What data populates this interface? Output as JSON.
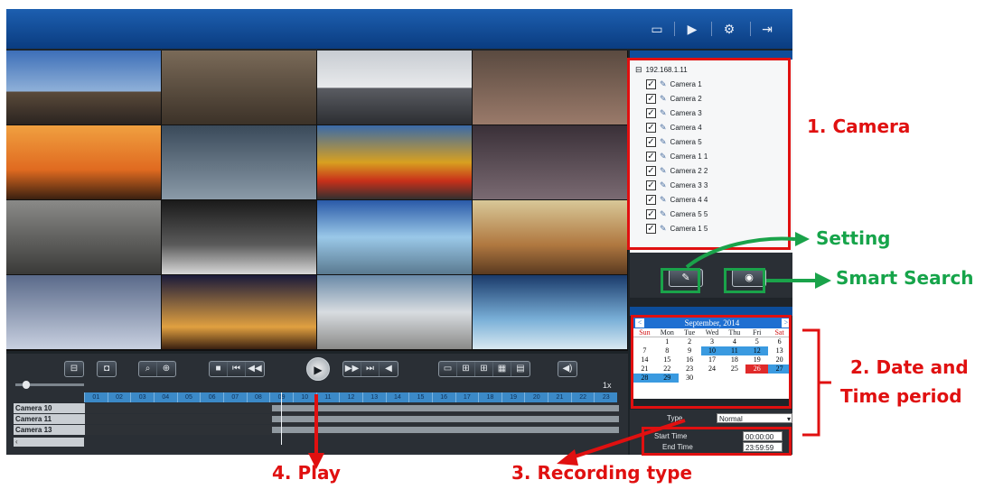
{
  "topbar": {
    "icons": [
      "monitor-icon",
      "play-box-icon",
      "gear-icon",
      "exit-icon"
    ]
  },
  "controls": {
    "zoom_level": "1x",
    "hours": [
      "01",
      "02",
      "03",
      "04",
      "05",
      "06",
      "07",
      "08",
      "09",
      "10",
      "11",
      "12",
      "13",
      "14",
      "15",
      "16",
      "17",
      "18",
      "19",
      "20",
      "21",
      "22",
      "23"
    ]
  },
  "timeline": {
    "rows": [
      "Camera 10",
      "Camera 11",
      "Camera 13"
    ]
  },
  "device": {
    "ip": "192.168.1.11"
  },
  "cameras": [
    "Camera 1",
    "Camera 2",
    "Camera 3",
    "Camera 4",
    "Camera 5",
    "Camera 1 1",
    "Camera 2 2",
    "Camera 3 3",
    "Camera 4 4",
    "Camera 5 5",
    "Camera 1 5"
  ],
  "calendar": {
    "title": "September, 2014",
    "prev": "<",
    "next": ">",
    "weekdays": [
      "Sun",
      "Mon",
      "Tue",
      "Wed",
      "Thu",
      "Fri",
      "Sat"
    ],
    "weeks": [
      [
        "",
        "1",
        "2",
        "3",
        "4",
        "5",
        "6"
      ],
      [
        "7",
        "8",
        "9",
        "10",
        "11",
        "12",
        "13"
      ],
      [
        "14",
        "15",
        "16",
        "17",
        "18",
        "19",
        "20"
      ],
      [
        "21",
        "22",
        "23",
        "24",
        "25",
        "26",
        "27"
      ],
      [
        "28",
        "29",
        "30",
        "",
        "",
        "",
        ""
      ]
    ],
    "recorded_days": [
      "10",
      "11",
      "12",
      "26",
      "27",
      "28",
      "29"
    ],
    "selected_day": "26"
  },
  "search": {
    "type_label": "Type",
    "type_value": "Normal",
    "start_label": "Start Time",
    "start_value": "00:00:00",
    "end_label": "End Time",
    "end_value": "23:59:59"
  },
  "annotations": {
    "camera": "1. Camera",
    "setting": "Setting",
    "smart_search": "Smart Search",
    "date_time": "2. Date and",
    "date_time2": "Time period",
    "play": "4. Play",
    "recording_type": "3. Recording type"
  },
  "colors": {
    "annotation_red": "#e01010",
    "annotation_green": "#16a44a",
    "accent_blue": "#1f6fd1"
  }
}
